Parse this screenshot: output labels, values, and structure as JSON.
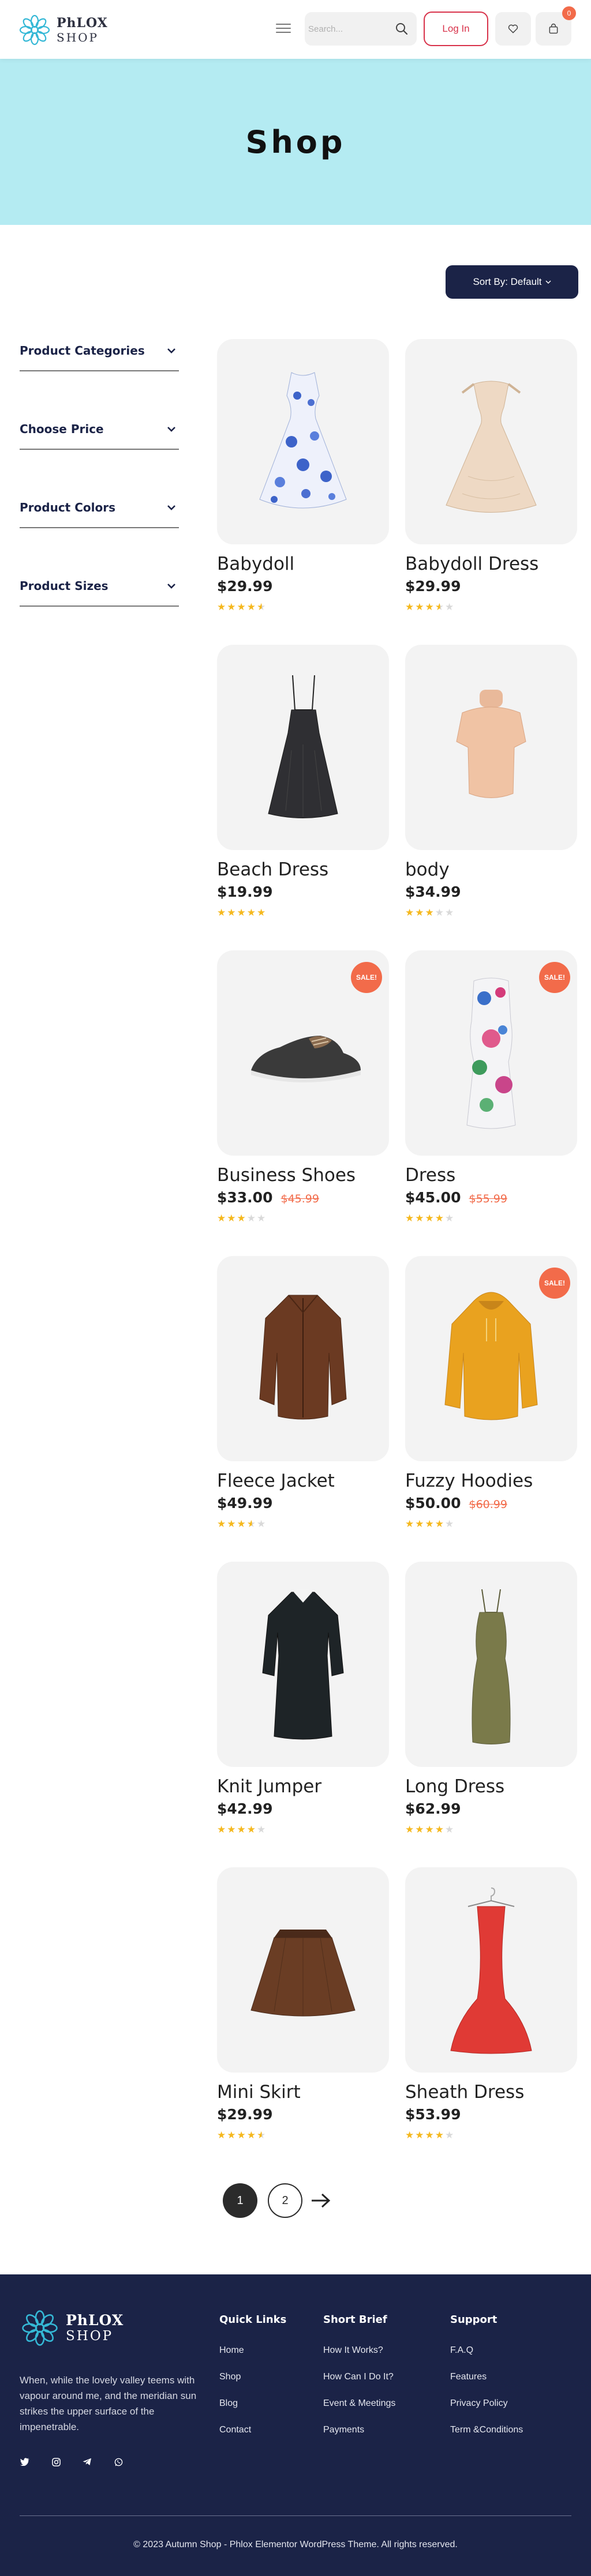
{
  "header": {
    "brand_line1": "PhLOX",
    "brand_line2": "SHOP",
    "search_placeholder": "Search...",
    "login_label": "Log In",
    "cart_count": "0"
  },
  "hero": {
    "title": "Shop"
  },
  "sort": {
    "label": "Sort By: Default"
  },
  "filters": [
    {
      "label": "Product Categories"
    },
    {
      "label": "Choose Price"
    },
    {
      "label": "Product Colors"
    },
    {
      "label": "Product Sizes"
    }
  ],
  "products": [
    {
      "name": "Babydoll",
      "price": "$29.99",
      "old_price": "",
      "sale": false,
      "rating": 4.5
    },
    {
      "name": "Babydoll Dress",
      "price": "$29.99",
      "old_price": "",
      "sale": false,
      "rating": 3.5
    },
    {
      "name": "Beach Dress",
      "price": "$19.99",
      "old_price": "",
      "sale": false,
      "rating": 5
    },
    {
      "name": "body",
      "price": "$34.99",
      "old_price": "",
      "sale": false,
      "rating": 3
    },
    {
      "name": "Business Shoes",
      "price": "$33.00",
      "old_price": "$45.99",
      "sale": true,
      "sale_label": "SALE!",
      "rating": 3
    },
    {
      "name": "Dress",
      "price": "$45.00",
      "old_price": "$55.99",
      "sale": true,
      "sale_label": "SALE!",
      "rating": 4
    },
    {
      "name": "Fleece Jacket",
      "price": "$49.99",
      "old_price": "",
      "sale": false,
      "rating": 3.5
    },
    {
      "name": "Fuzzy Hoodies",
      "price": "$50.00",
      "old_price": "$60.99",
      "sale": true,
      "sale_label": "SALE!",
      "rating": 4
    },
    {
      "name": "Knit Jumper",
      "price": "$42.99",
      "old_price": "",
      "sale": false,
      "rating": 4
    },
    {
      "name": "Long Dress",
      "price": "$62.99",
      "old_price": "",
      "sale": false,
      "rating": 4
    },
    {
      "name": "Mini Skirt",
      "price": "$29.99",
      "old_price": "",
      "sale": false,
      "rating": 4.5
    },
    {
      "name": "Sheath Dress",
      "price": "$53.99",
      "old_price": "",
      "sale": false,
      "rating": 4
    }
  ],
  "pagination": {
    "page1": "1",
    "page2": "2"
  },
  "footer": {
    "brand_line1": "PhLOX",
    "brand_line2": "SHOP",
    "description": "When, while the lovely valley teems with vapour around me, and the meridian sun strikes the upper surface of the impenetrable.",
    "quick_links": {
      "title": "Quick Links",
      "items": [
        "Home",
        "Shop",
        "Blog",
        "Contact"
      ]
    },
    "short_brief": {
      "title": "Short Brief",
      "items": [
        "How It Works?",
        "How Can I Do It?",
        "Event & Meetings",
        "Payments"
      ]
    },
    "support": {
      "title": "Support",
      "items": [
        "F.A.Q",
        "Features",
        "Privacy Policy",
        "Term &Conditions"
      ]
    },
    "copyright": "© 2023 Autumn Shop - Phlox Elementor WordPress Theme. All rights reserved."
  },
  "colors": {
    "accent": "#d8324a",
    "navy": "#1b2347",
    "hero_bg": "#b4ebf2",
    "sale": "#f26b4a",
    "star": "#f5b81e"
  }
}
